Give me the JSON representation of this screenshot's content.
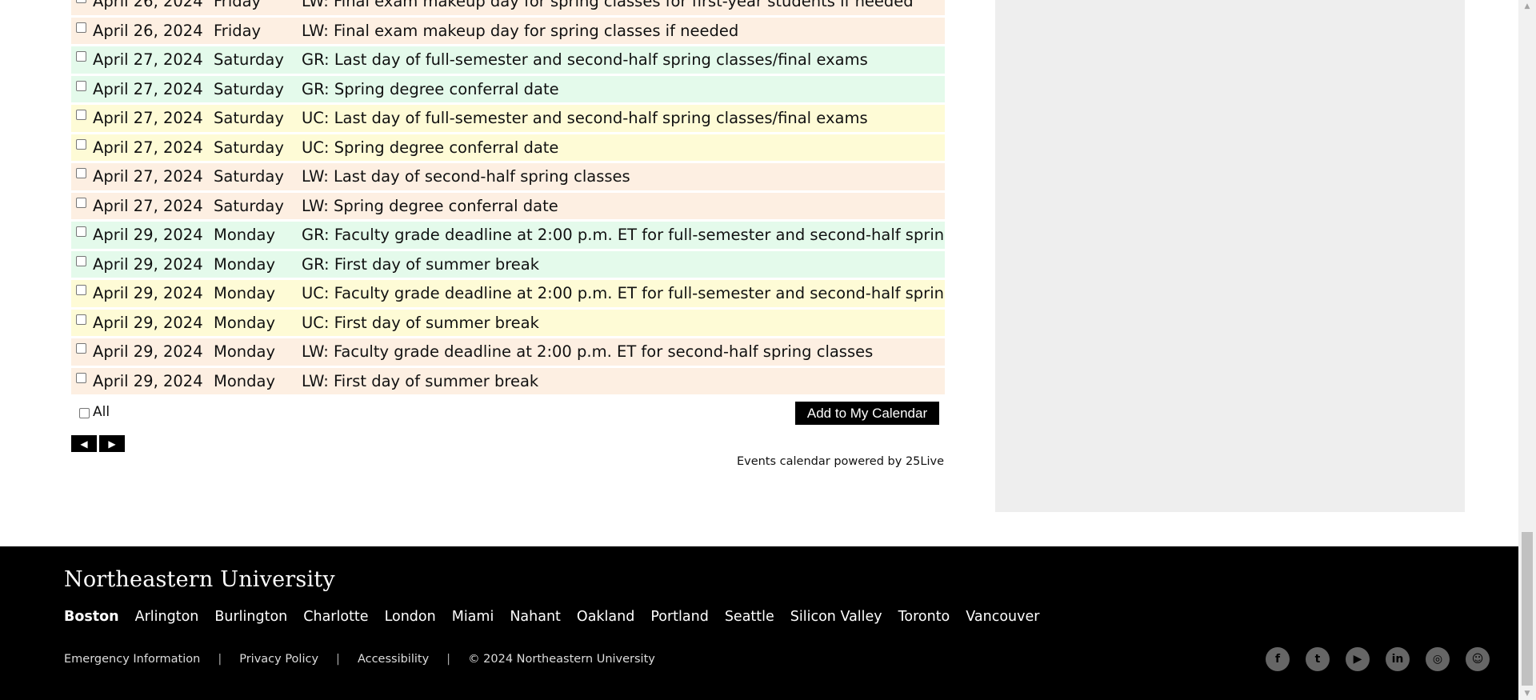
{
  "events": [
    {
      "date": "April 26, 2024",
      "day": "Friday",
      "desc": "LW: Final exam makeup day for spring classes for first-year students if needed",
      "group": "lw"
    },
    {
      "date": "April 26, 2024",
      "day": "Friday",
      "desc": "LW: Final exam makeup day for spring classes if needed",
      "group": "lw"
    },
    {
      "date": "April 27, 2024",
      "day": "Saturday",
      "desc": "GR: Last day of full-semester and second-half spring classes/final exams",
      "group": "gr"
    },
    {
      "date": "April 27, 2024",
      "day": "Saturday",
      "desc": "GR: Spring degree conferral date",
      "group": "gr"
    },
    {
      "date": "April 27, 2024",
      "day": "Saturday",
      "desc": "UC: Last day of full-semester and second-half spring classes/final exams",
      "group": "uc"
    },
    {
      "date": "April 27, 2024",
      "day": "Saturday",
      "desc": "UC: Spring degree conferral date",
      "group": "uc"
    },
    {
      "date": "April 27, 2024",
      "day": "Saturday",
      "desc": "LW: Last day of second-half spring classes",
      "group": "lw"
    },
    {
      "date": "April 27, 2024",
      "day": "Saturday",
      "desc": "LW: Spring degree conferral date",
      "group": "lw"
    },
    {
      "date": "April 29, 2024",
      "day": "Monday",
      "desc": "GR: Faculty grade deadline at 2:00 p.m. ET for full-semester and second-half spring classes",
      "group": "gr"
    },
    {
      "date": "April 29, 2024",
      "day": "Monday",
      "desc": "GR: First day of summer break",
      "group": "gr"
    },
    {
      "date": "April 29, 2024",
      "day": "Monday",
      "desc": "UC: Faculty grade deadline at 2:00 p.m. ET for full-semester and second-half spring classes",
      "group": "uc"
    },
    {
      "date": "April 29, 2024",
      "day": "Monday",
      "desc": "UC: First day of summer break",
      "group": "uc"
    },
    {
      "date": "April 29, 2024",
      "day": "Monday",
      "desc": "LW: Faculty grade deadline at 2:00 p.m. ET for second-half spring classes",
      "group": "lw"
    },
    {
      "date": "April 29, 2024",
      "day": "Monday",
      "desc": "LW: First day of summer break",
      "group": "lw"
    }
  ],
  "group_colors": {
    "gr": "#e4faeb",
    "uc": "#fefbd6",
    "lw": "#fdefe2"
  },
  "controls": {
    "all_label": "All",
    "add_button": "Add to My Calendar",
    "prev_icon": "◀",
    "next_icon": "▶",
    "powered_by": "Events calendar powered by 25Live"
  },
  "footer": {
    "logo_text": "Northeastern University",
    "campuses": [
      "Boston",
      "Arlington",
      "Burlington",
      "Charlotte",
      "London",
      "Miami",
      "Nahant",
      "Oakland",
      "Portland",
      "Seattle",
      "Silicon Valley",
      "Toronto",
      "Vancouver"
    ],
    "active_campus": "Boston",
    "legal": [
      "Emergency Information",
      "Privacy Policy",
      "Accessibility",
      "© 2024 Northeastern University"
    ],
    "separator": "|",
    "social": [
      {
        "name": "facebook-icon",
        "glyph": "f"
      },
      {
        "name": "twitter-icon",
        "glyph": "t"
      },
      {
        "name": "youtube-icon",
        "glyph": "▶"
      },
      {
        "name": "linkedin-icon",
        "glyph": "in"
      },
      {
        "name": "instagram-icon",
        "glyph": "◎"
      },
      {
        "name": "snapchat-icon",
        "glyph": "☺"
      }
    ]
  },
  "scrollbar": {
    "up_icon": "▲",
    "down_icon": "▼"
  }
}
